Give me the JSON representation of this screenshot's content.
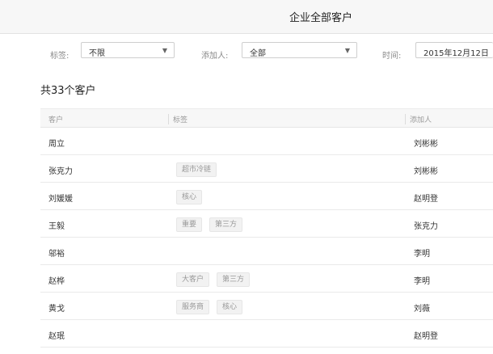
{
  "header": {
    "title": "企业全部客户"
  },
  "filters": {
    "tag_label": "标签:",
    "tag_value": "不限",
    "adder_label": "添加人:",
    "adder_value": "全部",
    "time_label": "时间:",
    "time_value": "2015年12月12日"
  },
  "summary": {
    "count_text": "共33个客户"
  },
  "table": {
    "columns": [
      "客户",
      "标签",
      "添加人"
    ],
    "rows": [
      {
        "name": "周立",
        "tags": [],
        "adder": "刘彬彬"
      },
      {
        "name": "张克力",
        "tags": [
          "超市冷链"
        ],
        "adder": "刘彬彬"
      },
      {
        "name": "刘媛媛",
        "tags": [
          "核心"
        ],
        "adder": "赵明登"
      },
      {
        "name": "王毅",
        "tags": [
          "重要",
          "第三方"
        ],
        "adder": "张克力"
      },
      {
        "name": "邬裕",
        "tags": [],
        "adder": "李明"
      },
      {
        "name": "赵桦",
        "tags": [
          "大客户",
          "第三方"
        ],
        "adder": "李明"
      },
      {
        "name": "黄戈",
        "tags": [
          "服务商",
          "核心"
        ],
        "adder": "刘薇"
      },
      {
        "name": "赵珉",
        "tags": [],
        "adder": "赵明登"
      }
    ]
  }
}
